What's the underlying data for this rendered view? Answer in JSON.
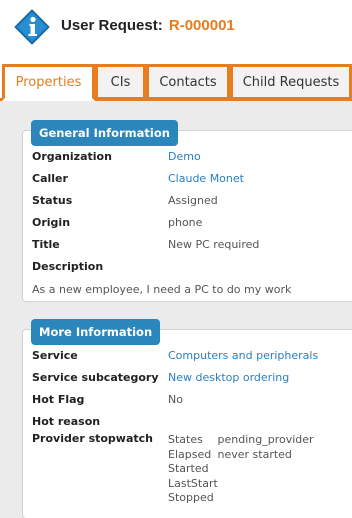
{
  "header": {
    "title_prefix": "User Request:",
    "ref": "R-000001",
    "logo_icon": "info-icon",
    "accent_color": "#e87c1e",
    "logo_color": "#1b7fc0"
  },
  "tabs": [
    {
      "label": "Properties",
      "active": true
    },
    {
      "label": "CIs",
      "active": false
    },
    {
      "label": "Contacts",
      "active": false
    },
    {
      "label": "Child Requests",
      "active": false
    }
  ],
  "general": {
    "legend": "General Information",
    "organization_label": "Organization",
    "organization_value": "Demo",
    "caller_label": "Caller",
    "caller_value": "Claude Monet",
    "status_label": "Status",
    "status_value": "Assigned",
    "origin_label": "Origin",
    "origin_value": "phone",
    "title_label": "Title",
    "title_value": "New PC required",
    "description_label": "Description",
    "description_value": "As a new employee, I need a PC to do my work"
  },
  "more": {
    "legend": "More Information",
    "service_label": "Service",
    "service_value": "Computers and peripherals",
    "subcategory_label": "Service subcategory",
    "subcategory_value": "New desktop ordering",
    "hotflag_label": "Hot Flag",
    "hotflag_value": "No",
    "hotreason_label": "Hot reason",
    "stopwatch_label": "Provider stopwatch",
    "stopwatch": {
      "states_key": "States",
      "states_value": "pending_provider",
      "elapsed_key": "Elapsed",
      "elapsed_value": "never started",
      "started_key": "Started",
      "laststart_key": "LastStart",
      "stopped_key": "Stopped"
    }
  }
}
